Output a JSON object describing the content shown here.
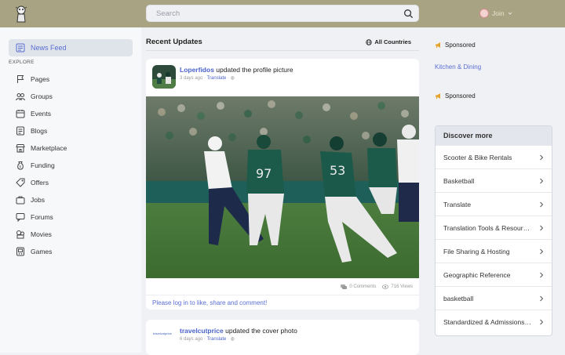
{
  "header": {
    "search_placeholder": "Search",
    "login_label": "Join"
  },
  "sidebar": {
    "news_feed": "News Feed",
    "explore_label": "EXPLORE",
    "items": [
      {
        "label": "Pages",
        "icon": "flag-icon"
      },
      {
        "label": "Groups",
        "icon": "groups-icon"
      },
      {
        "label": "Events",
        "icon": "calendar-icon"
      },
      {
        "label": "Blogs",
        "icon": "blog-icon"
      },
      {
        "label": "Marketplace",
        "icon": "store-icon"
      },
      {
        "label": "Funding",
        "icon": "funding-icon"
      },
      {
        "label": "Offers",
        "icon": "tag-icon"
      },
      {
        "label": "Jobs",
        "icon": "briefcase-icon"
      },
      {
        "label": "Forums",
        "icon": "forum-icon"
      },
      {
        "label": "Movies",
        "icon": "movie-icon"
      },
      {
        "label": "Games",
        "icon": "game-icon"
      }
    ]
  },
  "main": {
    "title": "Recent Updates",
    "filter_label": "All Countries",
    "posts": [
      {
        "username": "Loperfidos",
        "action": "updated the profile picture",
        "time": "3 days ago",
        "translate": "Translate",
        "comments": "0 Comments",
        "views": "716 Views",
        "prompt": "Please log in to like, share and comment!"
      },
      {
        "username": "travelcutprice",
        "action": "updated the cover photo",
        "time": "6 days ago",
        "translate": "Translate",
        "avatar_text": "travelcutprice"
      }
    ]
  },
  "right": {
    "sponsored_label": "Sponsored",
    "ad_link": "Kitchen & Dining",
    "discover_title": "Discover more",
    "discover_items": [
      "Scooter & Bike Rentals",
      "Basketball",
      "Translate",
      "Translation Tools & Resources",
      "File Sharing & Hosting",
      "Geographic Reference",
      "basketball",
      "Standardized & Admissions Tests"
    ]
  },
  "colors": {
    "header_bg": "#a8a483",
    "accent": "#4a63c9",
    "field_green": "#3d7a3a"
  }
}
